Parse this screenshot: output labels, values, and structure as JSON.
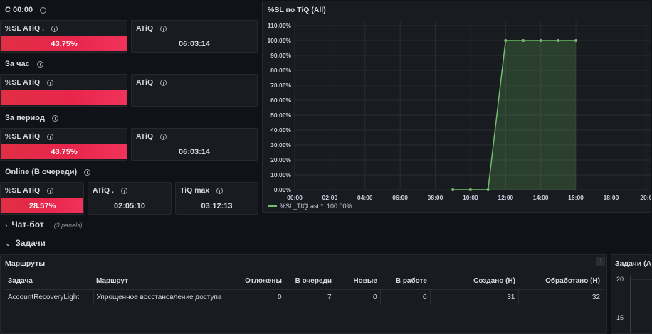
{
  "colors": {
    "gauge": "#e8264c",
    "series": "#73bf69",
    "background": "#111217",
    "panel": "#181b1f"
  },
  "sections": {
    "today": {
      "title": "С 00:00",
      "sl_title": "%SL ATiQ .",
      "sl_value": "43.75%",
      "sl_fill": 1.0,
      "atiq_title": "ATiQ",
      "atiq_value": "06:03:14"
    },
    "hour": {
      "title": "За час",
      "sl_title": "%SL ATiQ",
      "sl_fill": 1.0,
      "atiq_title": "ATiQ"
    },
    "period": {
      "title": "За период",
      "sl_title": "%SL ATiQ",
      "sl_value": "43.75%",
      "sl_fill": 1.0,
      "atiq_title": "ATiQ",
      "atiq_value": "06:03:14"
    },
    "online": {
      "title": "Online (В очереди)",
      "sl_title": "%SL ATiQ",
      "sl_value": "28.57%",
      "sl_fill": 1.0,
      "atiq_title": "ATiQ .",
      "atiq_value": "02:05:10",
      "tiq_title": "TiQ max",
      "tiq_value": "03:12:13"
    }
  },
  "chart_panel": {
    "title": "%SL по TiQ (All)",
    "legend_name": "%SL_TIQ",
    "legend_stat": "Last *: 100.00%"
  },
  "chart_data": {
    "type": "area",
    "series": [
      {
        "name": "%SL_TIQ",
        "x": [
          "09:00",
          "10:00",
          "11:00",
          "12:00",
          "13:00",
          "14:00",
          "15:00",
          "16:00"
        ],
        "values": [
          0,
          0,
          0,
          100,
          100,
          100,
          100,
          100
        ]
      }
    ],
    "x_ticks": [
      "00:00",
      "02:00",
      "04:00",
      "06:00",
      "08:00",
      "10:00",
      "12:00",
      "14:00",
      "16:00",
      "18:00",
      "20:0"
    ],
    "y_ticks": [
      "0.00%",
      "10.00%",
      "20.00%",
      "30.00%",
      "40.00%",
      "50.00%",
      "60.00%",
      "70.00%",
      "80.00%",
      "90.00%",
      "100.00%",
      "110.00%"
    ],
    "xlim": [
      0,
      20.25
    ],
    "ylim": [
      0,
      110
    ],
    "grid": true,
    "legend_position": "bottom-left"
  },
  "rows": {
    "chatbot": {
      "label": "Чат-бот",
      "sub": "(3 panels)"
    },
    "tasks": {
      "label": "Задачи"
    }
  },
  "routes_panel": {
    "title": "Маршруты",
    "columns": [
      "Задача",
      "Маршрут",
      "Отложены",
      "В очереди",
      "Новые",
      "В работе",
      "Создано (Н)",
      "Обработано (Н)"
    ],
    "rows": [
      [
        "AccountRecoveryLight",
        "Упрощенное восстановление доступа",
        "0",
        "7",
        "0",
        "0",
        "31",
        "32"
      ]
    ]
  },
  "tasks_panel": {
    "title": "Задачи (All",
    "y_ticks": [
      "20",
      "15"
    ]
  }
}
